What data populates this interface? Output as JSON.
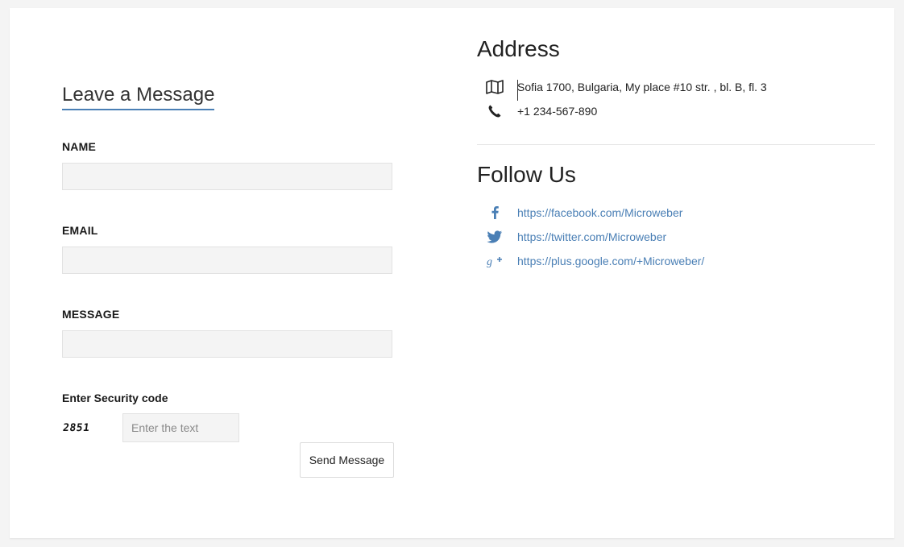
{
  "form": {
    "title": "Leave a Message",
    "name_label": "NAME",
    "name_value": "",
    "email_label": "EMAIL",
    "email_value": "",
    "message_label": "MESSAGE",
    "message_value": "",
    "security_label": "Enter Security code",
    "captcha_code": "2851",
    "captcha_placeholder": "Enter the text",
    "submit_label": "Send Message"
  },
  "address": {
    "title": "Address",
    "street": "Sofia 1700, Bulgaria, My place #10 str. , bl. B, fl. 3",
    "phone": "+1 234-567-890",
    "icons": [
      "map-icon",
      "phone-icon"
    ]
  },
  "follow": {
    "title": "Follow Us",
    "links": [
      {
        "icon": "facebook-icon",
        "label": "https://facebook.com/Microweber"
      },
      {
        "icon": "twitter-icon",
        "label": "https://twitter.com/Microweber"
      },
      {
        "icon": "google-plus-icon",
        "label": "https://plus.google.com/+Microweber/"
      }
    ]
  },
  "colors": {
    "accent": "#4a7fb5",
    "input_bg": "#f4f4f4",
    "page_bg": "#f4f4f4"
  }
}
